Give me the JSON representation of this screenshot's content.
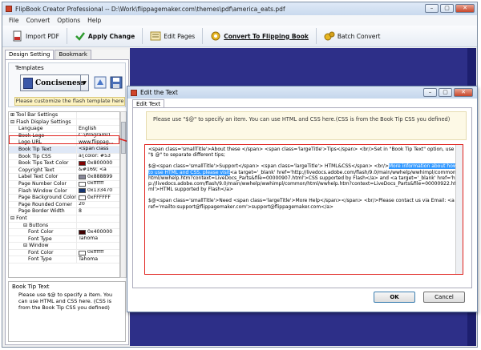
{
  "app": {
    "title": "FlipBook Creator Professional  --  D:\\Work\\flippagemaker.com\\themes\\pdf\\america_eats.pdf",
    "window_buttons": [
      "–",
      "▢",
      "✕"
    ]
  },
  "menu": [
    "File",
    "Convert",
    "Options",
    "Help"
  ],
  "toolbar": {
    "import_pdf": "Import PDF",
    "apply_change": "Apply Change",
    "edit_pages": "Edit Pages",
    "convert": "Convert To Flipping Book",
    "batch_convert": "Batch Convert"
  },
  "left": {
    "tabs": [
      "Design Setting",
      "Bookmark"
    ],
    "templates_label": "Templates",
    "template_name": "Conciseness",
    "customize_hint": "Please customize the flash template here",
    "props": [
      {
        "k": "Tool Bar Settings",
        "v": "",
        "type": "group",
        "sign": "⊞"
      },
      {
        "k": "Flash Display Settings",
        "v": "",
        "type": "group",
        "sign": "⊟"
      },
      {
        "k": "Language",
        "v": "English",
        "type": "item"
      },
      {
        "k": "Book Logo",
        "v": "C:\\ProgramD...",
        "type": "item"
      },
      {
        "k": "Logo URL",
        "v": "www.flippag...",
        "type": "item"
      },
      {
        "k": "Book Tip Text",
        "v": "<span class",
        "type": "item",
        "hl": true
      },
      {
        "k": "Book Tip CSS",
        "v": "a{color: #53",
        "type": "item"
      },
      {
        "k": "Book Tips Text Color",
        "v": "0x800000",
        "type": "color",
        "c": "#800000"
      },
      {
        "k": "Copyright Text",
        "v": "&#169; <a",
        "type": "item"
      },
      {
        "k": "Label Text Color",
        "v": "0x888899",
        "type": "color",
        "c": "#888899"
      },
      {
        "k": "Page Number Color",
        "v": "0xffffff",
        "type": "color",
        "c": "#ffffff"
      },
      {
        "k": "Flash Window Color",
        "v": "0x133470",
        "type": "color",
        "c": "#133470"
      },
      {
        "k": "Page Background Color",
        "v": "0xFFFFFF",
        "type": "color",
        "c": "#ffffff"
      },
      {
        "k": "Page Rounded Corner",
        "v": "20",
        "type": "item"
      },
      {
        "k": "Page Border Width",
        "v": "8",
        "type": "item"
      },
      {
        "k": "Font",
        "v": "",
        "type": "group",
        "sign": "⊟"
      },
      {
        "k": "Buttons",
        "v": "",
        "type": "sub",
        "sign": "⊟"
      },
      {
        "k": "Font Color",
        "v": "0x400000",
        "type": "color2",
        "c": "#400000"
      },
      {
        "k": "Font Type",
        "v": "Tahoma",
        "type": "sub2"
      },
      {
        "k": "Window",
        "v": "",
        "type": "sub",
        "sign": "⊟"
      },
      {
        "k": "Font Color",
        "v": "0xffffff",
        "type": "color2",
        "c": "#ffffff"
      },
      {
        "k": "Font Type",
        "v": "Tahoma",
        "type": "sub2"
      }
    ],
    "help_title": "Book Tip Text",
    "help_body": "Please use $@ to specify a item. You can use HTML and CSS here. (CSS is from the Book Tip CSS you defined)"
  },
  "dialog": {
    "title": "Edit the Text",
    "tab": "Edit Text",
    "note": "Please use \"$@\" to specify an item. You can use HTML and CSS here.(CSS is from the Book Tip CSS you defined)",
    "editor_lines": [
      {
        "pre": "<span class='smallTitle'>About these </span> <span class='largeTitle'>Tips</span> <br/>Set in \"Book Tip Text\" option, use \"$ @\" to separate different tips;",
        "hl": "",
        "post": ""
      },
      {
        "pre": "",
        "hl": "",
        "post": ""
      },
      {
        "pre": "$@<span class='smallTitle'>Support</span> <span class='largeTitle'> HTML&CSS</span> <br/>",
        "hl": "More information about how to use HTML and CSS, please visit",
        "post": "<a target='_blank' href='http://livedocs.adobe.com/flash/9.0/main/wwhelp/wwhimpl/common/html/wwhelp.htm?context=LiveDocs_Parts&file=00000907.html'>CSS supported by Flash</a> and <a target='_blank' href='http://livedocs.adobe.com/flash/9.0/main/wwhelp/wwhimpl/common/html/wwhelp.htm?context=LiveDocs_Parts&file=00000922.html'>HTML supported by Flash</a>"
      },
      {
        "pre": "",
        "hl": "",
        "post": ""
      },
      {
        "pre": "$@<span class='smallTitle'>Need <span class='largeTitle'>More Help</span></span>  <br/>Please contact us via Email: <a href='mailto:support@flippagemaker.com'>support@flippagemaker.com</a>",
        "hl": "",
        "post": ""
      }
    ],
    "ok": "OK",
    "cancel": "Cancel"
  },
  "colors": {
    "highlight": "#e0201b",
    "preview_bg": "#2d2f88"
  }
}
